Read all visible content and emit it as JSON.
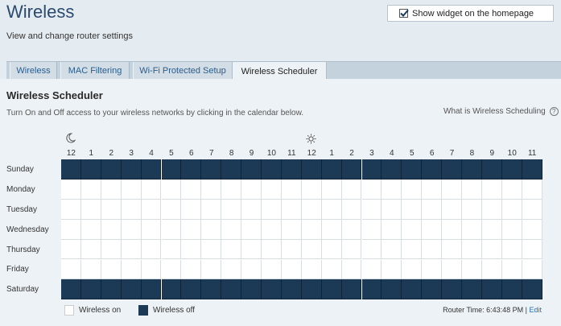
{
  "header": {
    "title": "Wireless",
    "subtitle": "View and change router settings",
    "widget_checkbox_label": "Show widget on the homepage",
    "widget_checked": true
  },
  "tabs": [
    {
      "label": "Wireless",
      "active": false
    },
    {
      "label": "MAC Filtering",
      "active": false
    },
    {
      "label": "Wi-Fi Protected Setup",
      "active": false
    },
    {
      "label": "Wireless Scheduler",
      "active": true
    }
  ],
  "scheduler": {
    "title": "Wireless Scheduler",
    "description": "Turn On and Off access to your wireless networks by clicking in the calendar below.",
    "help_link": "What is Wireless Scheduling",
    "hours": [
      "12",
      "1",
      "2",
      "3",
      "4",
      "5",
      "6",
      "7",
      "8",
      "9",
      "10",
      "11",
      "12",
      "1",
      "2",
      "3",
      "4",
      "5",
      "6",
      "7",
      "8",
      "9",
      "10",
      "11"
    ],
    "night_icon": "moon-icon",
    "day_icon": "sun-icon",
    "days": [
      {
        "name": "Sunday",
        "state": "off"
      },
      {
        "name": "Monday",
        "state": "on"
      },
      {
        "name": "Tuesday",
        "state": "on"
      },
      {
        "name": "Wednesday",
        "state": "on"
      },
      {
        "name": "Thursday",
        "state": "on"
      },
      {
        "name": "Friday",
        "state": "on"
      },
      {
        "name": "Saturday",
        "state": "off"
      }
    ]
  },
  "legend": {
    "on_label": "Wireless on",
    "off_label": "Wireless off",
    "on_color": "#ffffff",
    "off_color": "#1c3a55"
  },
  "footer": {
    "router_time_label": "Router Time: 6:43:48 PM",
    "separator": " | ",
    "edit_label": "Edit"
  }
}
